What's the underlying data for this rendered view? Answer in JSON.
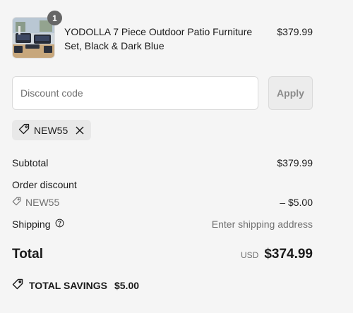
{
  "product": {
    "title": "YODOLLA 7 Piece Outdoor Patio Furniture Set, Black & Dark Blue",
    "price": "$379.99",
    "quantity": "1",
    "image_icon": "patio-furniture-thumbnail"
  },
  "discount": {
    "placeholder": "Discount code",
    "apply_label": "Apply"
  },
  "applied_code": {
    "code": "NEW55",
    "tag_icon": "tag-icon",
    "remove_icon": "close-icon"
  },
  "summary": {
    "subtotal_label": "Subtotal",
    "subtotal_value": "$379.99",
    "order_discount_label": "Order discount",
    "discount_code": "NEW55",
    "discount_value": "– $5.00",
    "shipping_label": "Shipping",
    "shipping_value": "Enter shipping address",
    "total_label": "Total",
    "currency": "USD",
    "total_value": "$374.99"
  },
  "savings": {
    "label": "TOTAL SAVINGS",
    "amount": "$5.00"
  },
  "colors": {
    "background": "#f5f5f5",
    "badge": "#666666",
    "muted_text": "#707070",
    "chip": "#e8e8e8"
  }
}
